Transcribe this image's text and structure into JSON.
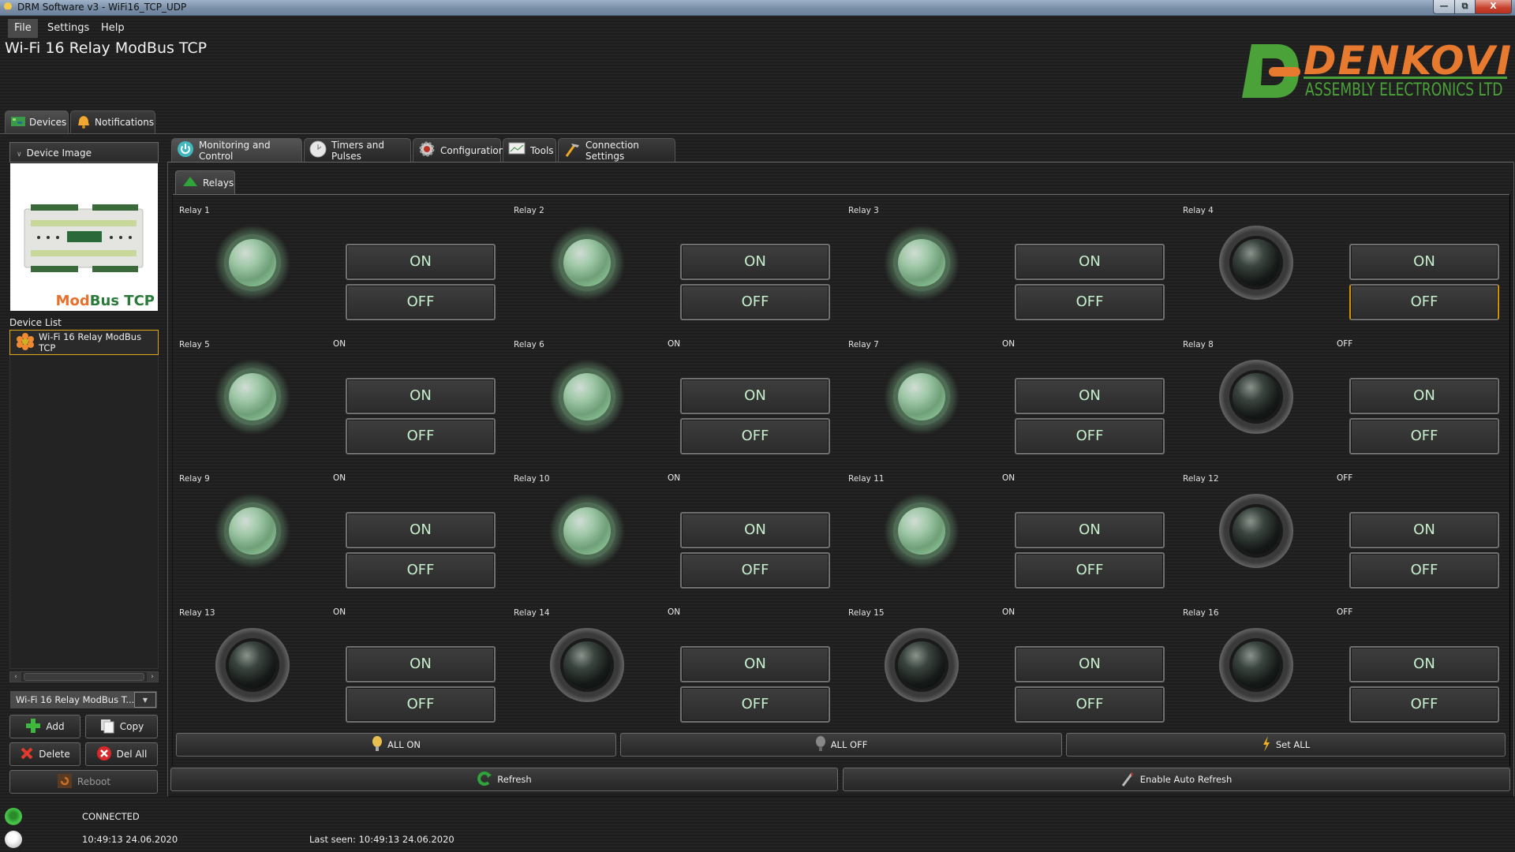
{
  "window": {
    "title": "DRM Software v3 - WiFi16_TCP_UDP",
    "minimize": "—",
    "restore": "⧉",
    "close": "X"
  },
  "menu": [
    {
      "label": "File",
      "active": true
    },
    {
      "label": "Settings"
    },
    {
      "label": "Help"
    }
  ],
  "app_title": "Wi-Fi 16 Relay ModBus TCP",
  "logo": {
    "brand": "DENKOVI",
    "subtitle": "ASSEMBLY ELECTRONICS LTD",
    "orange": "#e87a30",
    "green": "#4aa238"
  },
  "left_tabs": [
    {
      "label": "Devices",
      "icon": "circuit-board-icon",
      "active": true
    },
    {
      "label": "Notifications",
      "icon": "bell-icon"
    }
  ],
  "left_panel": {
    "device_image_header": "Device Image",
    "device_image_caption_a": "Mod",
    "device_image_caption_b": "Bus TCP",
    "device_list_label": "Device List",
    "device_list_items": [
      "Wi-Fi 16 Relay ModBus TCP"
    ],
    "device_select_value": "Wi-Fi 16 Relay ModBus T...",
    "buttons": {
      "add": "Add",
      "copy": "Copy",
      "delete": "Delete",
      "del_all": "Del All",
      "reboot": "Reboot"
    }
  },
  "main_tabs": [
    {
      "label": "Monitoring and Control",
      "icon": "power-icon",
      "active": true
    },
    {
      "label": "Timers and Pulses",
      "icon": "clock-icon"
    },
    {
      "label": "Configuration",
      "icon": "gear-icon"
    },
    {
      "label": "Tools",
      "icon": "tools-icon"
    },
    {
      "label": "Connection Settings",
      "icon": "hammer-icon"
    }
  ],
  "sub_tab": "Relays",
  "relays": [
    {
      "label": "Relay 1",
      "state": "ON",
      "on_label": "ON",
      "off_label": "OFF"
    },
    {
      "label": "Relay 2",
      "state": "ON",
      "on_label": "ON",
      "off_label": "OFF"
    },
    {
      "label": "Relay 3",
      "state": "ON",
      "on_label": "ON",
      "off_label": "OFF"
    },
    {
      "label": "Relay 4",
      "state": "OFF",
      "on_label": "ON",
      "off_label": "OFF",
      "focused": "off"
    },
    {
      "label": "Relay 5",
      "state": "ON",
      "on_label": "ON",
      "off_label": "OFF"
    },
    {
      "label": "Relay 6",
      "state": "ON",
      "on_label": "ON",
      "off_label": "OFF"
    },
    {
      "label": "Relay 7",
      "state": "ON",
      "on_label": "ON",
      "off_label": "OFF"
    },
    {
      "label": "Relay 8",
      "state": "OFF",
      "on_label": "ON",
      "off_label": "OFF"
    },
    {
      "label": "Relay 9",
      "state": "ON",
      "on_label": "ON",
      "off_label": "OFF"
    },
    {
      "label": "Relay 10",
      "state": "ON",
      "on_label": "ON",
      "off_label": "OFF"
    },
    {
      "label": "Relay 11",
      "state": "ON",
      "on_label": "ON",
      "off_label": "OFF"
    },
    {
      "label": "Relay 12",
      "state": "OFF",
      "on_label": "ON",
      "off_label": "OFF"
    },
    {
      "label": "Relay 13",
      "state": "OFF",
      "on_label": "ON",
      "off_label": "OFF"
    },
    {
      "label": "Relay 14",
      "state": "OFF",
      "on_label": "ON",
      "off_label": "OFF"
    },
    {
      "label": "Relay 15",
      "state": "OFF",
      "on_label": "ON",
      "off_label": "OFF"
    },
    {
      "label": "Relay 16",
      "state": "OFF",
      "on_label": "ON",
      "off_label": "OFF"
    }
  ],
  "bulk_buttons": {
    "all_on": "ALL ON",
    "all_off": "ALL OFF",
    "set_all": "Set ALL"
  },
  "refresh_buttons": {
    "refresh": "Refresh",
    "auto_refresh": "Enable Auto Refresh"
  },
  "status": {
    "connection": "CONNECTED",
    "time": "10:49:13 24.06.2020",
    "last_seen": "Last seen: 10:49:13 24.06.2020",
    "connected_color": "#3cb83c"
  }
}
